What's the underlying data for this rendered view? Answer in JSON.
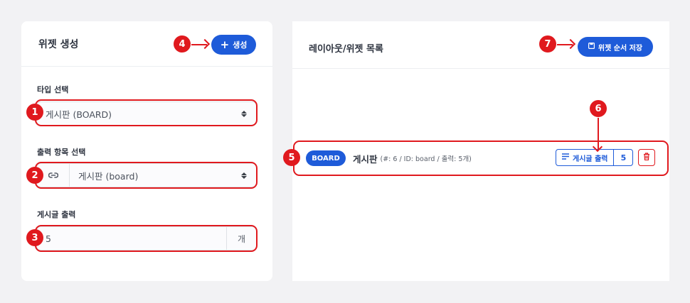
{
  "left_panel": {
    "title": "위젯 생성",
    "create_button": {
      "icon": "+",
      "label": "생성"
    },
    "type_field": {
      "label": "타입 선택",
      "value": "게시판 (BOARD)"
    },
    "output_item_field": {
      "label": "출력 항목 선택",
      "value": "게시판 (board)",
      "prefix_icon": "link-icon"
    },
    "post_output_field": {
      "label": "게시글 출력",
      "value": "5",
      "suffix": "개"
    }
  },
  "right_panel": {
    "title": "레이아웃/위젯 목록",
    "save_button": {
      "icon": "save-icon",
      "label": "위젯 순서 저장"
    },
    "widgets": [
      {
        "type": "BOARD",
        "name": "게시판",
        "meta": "(#: 6 / ID: board / 출력: 5개)",
        "output_label": "게시글 출력",
        "output_count": "5"
      }
    ]
  },
  "annotations": [
    "1",
    "2",
    "3",
    "4",
    "5",
    "6",
    "7"
  ],
  "colors": {
    "primary": "#1e5bd9",
    "annotation": "#e0191e",
    "background": "#f2f2f4"
  }
}
